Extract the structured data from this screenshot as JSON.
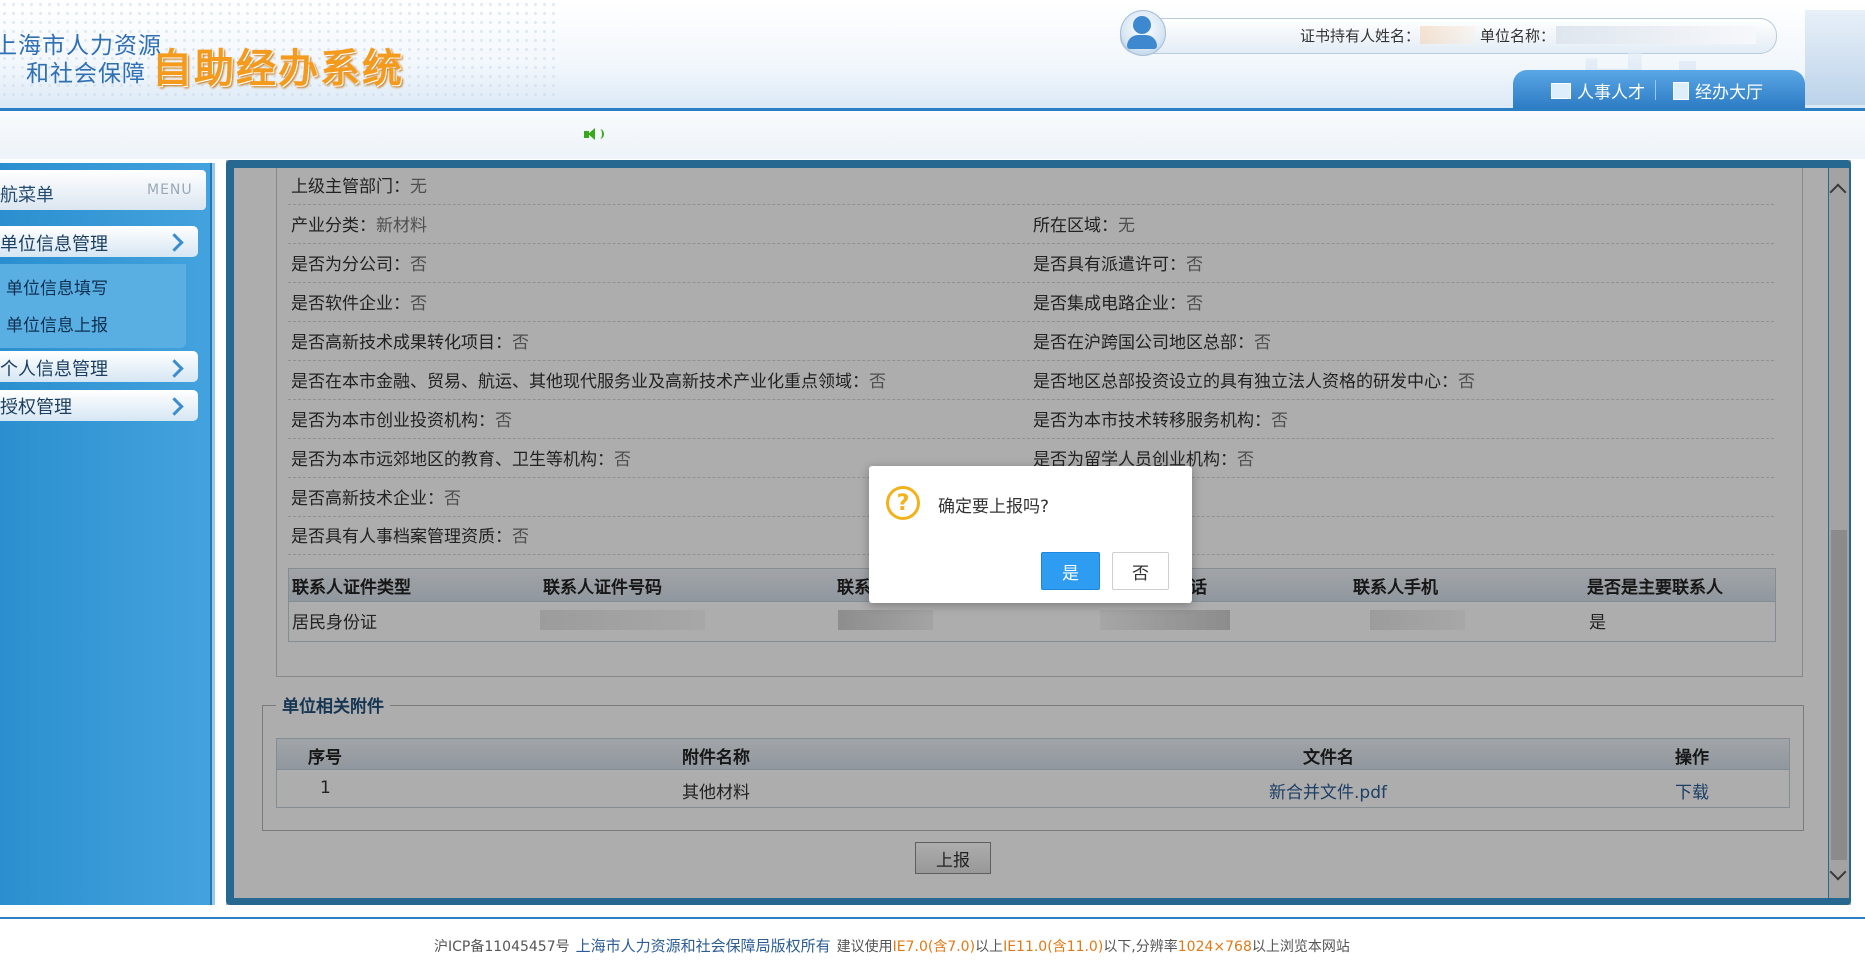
{
  "header": {
    "logo_line1": "上海市人力资源",
    "logo_line2": "和社会保障",
    "logo_big": "自助经办系统",
    "holder_label": "证书持有人姓名：",
    "unit_label": "单位名称：",
    "tabs": [
      {
        "label": "人事人才",
        "icon": "monitor-icon"
      },
      {
        "label": "经办大厅",
        "icon": "building-icon"
      }
    ]
  },
  "sidebar": {
    "title": "航菜单",
    "title_en": "MENU",
    "groups": [
      {
        "label": "单位信息管理"
      },
      {
        "label": "个人信息管理"
      },
      {
        "label": "授权管理"
      }
    ],
    "subitems": [
      {
        "label": "单位信息填写"
      },
      {
        "label": "单位信息上报"
      }
    ]
  },
  "info": {
    "rows": [
      {
        "left_label": "上级主管部门：",
        "left_value": "无",
        "right_label": "",
        "right_value": ""
      },
      {
        "left_label": "产业分类：",
        "left_value": "新材料",
        "right_label": "所在区域：",
        "right_value": "无"
      },
      {
        "left_label": "是否为分公司：",
        "left_value": "否",
        "right_label": "是否具有派遣许可：",
        "right_value": "否"
      },
      {
        "left_label": "是否软件企业：",
        "left_value": "否",
        "right_label": "是否集成电路企业：",
        "right_value": "否"
      },
      {
        "left_label": "是否高新技术成果转化项目：",
        "left_value": "否",
        "right_label": "是否在沪跨国公司地区总部：",
        "right_value": "否"
      },
      {
        "left_label": "是否在本市金融、贸易、航运、其他现代服务业及高新技术产业化重点领域：",
        "left_value": "否",
        "right_label": "是否地区总部投资设立的具有独立法人资格的研发中心：",
        "right_value": "否"
      },
      {
        "left_label": "是否为本市创业投资机构：",
        "left_value": "否",
        "right_label": "是否为本市技术转移服务机构：",
        "right_value": "否"
      },
      {
        "left_label": "是否为本市远郊地区的教育、卫生等机构：",
        "left_value": "否",
        "right_label": "是否为留学人员创业机构：",
        "right_value": "否"
      },
      {
        "left_label": "是否高新技术企业：",
        "left_value": "否",
        "right_label": "",
        "right_value": ""
      },
      {
        "left_label": "是否具有人事档案管理资质：",
        "left_value": "否",
        "right_label": "",
        "right_value": ""
      }
    ]
  },
  "contacts": {
    "headers": [
      "联系人证件类型",
      "联系人证件号码",
      "联系",
      "话",
      "联系人手机",
      "是否是主要联系人"
    ],
    "rows": [
      {
        "id_type": "居民身份证",
        "is_primary": "是"
      }
    ]
  },
  "attachments": {
    "legend": "单位相关附件",
    "headers": [
      "序号",
      "附件名称",
      "文件名",
      "操作"
    ],
    "rows": [
      {
        "index": "1",
        "name": "其他材料",
        "file": "新合并文件.pdf",
        "action": "下载"
      }
    ]
  },
  "submit_label": "上报",
  "dialog": {
    "message": "确定要上报吗?",
    "icon_glyph": "?",
    "yes": "是",
    "no": "否"
  },
  "footer": {
    "icp": "沪ICP备11045457号",
    "owner": "上海市人力资源和社会保障局版权所有",
    "advice_pre": "建议使用",
    "ie1": "IE7.0(含7.0)",
    "mid1": "以上",
    "ie2": "IE11.0(含11.0)",
    "mid2": "以下,分辨率",
    "res": "1024×768",
    "post": "以上浏览本网站"
  },
  "colors": {
    "brand_blue": "#2d7fc3",
    "logo_orange": "#f49b1e",
    "yes_button": "#2e9cf0",
    "question_icon": "#f2b21b"
  }
}
